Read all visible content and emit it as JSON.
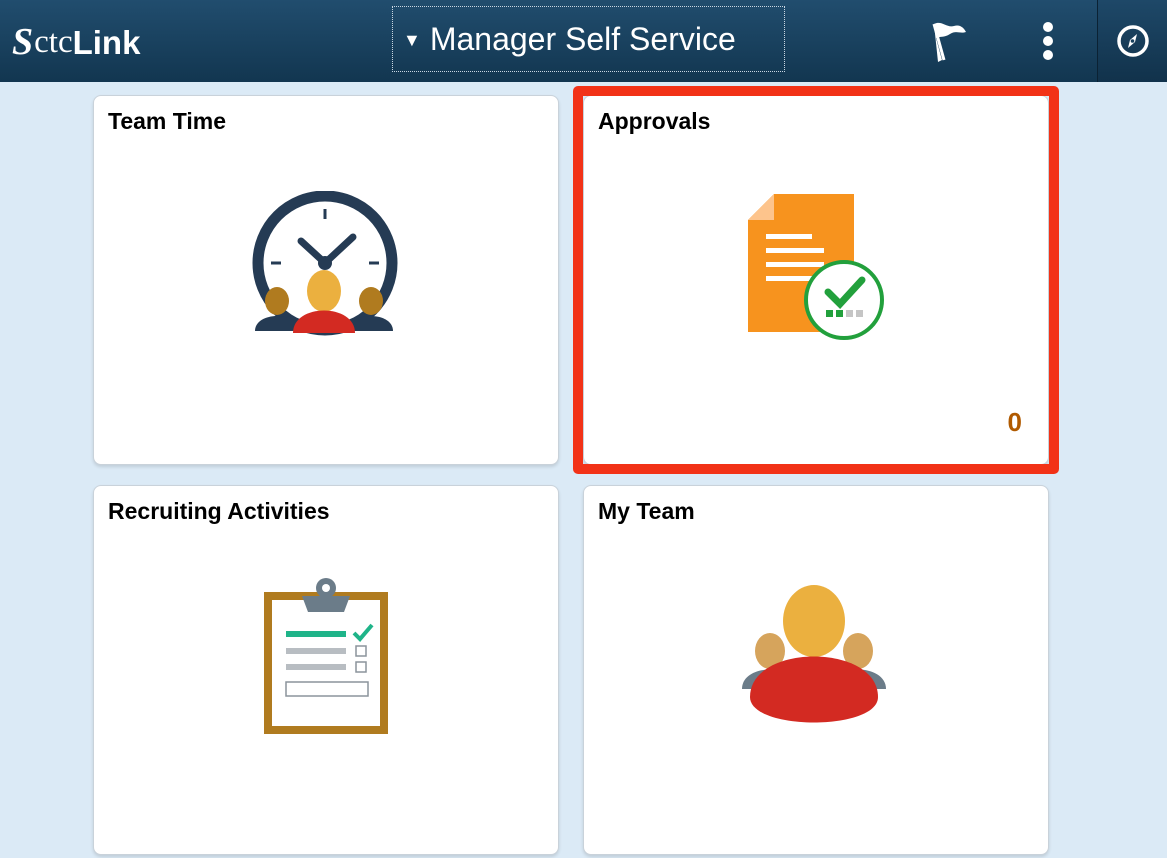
{
  "header": {
    "logo_s": "S",
    "logo_ctc": "ctc",
    "logo_link": "Link",
    "homepage_title": "Manager Self Service",
    "icons": {
      "homepage_dropdown": "triangle-down-icon",
      "notifications": "flag-icon",
      "actions": "vertical-ellipsis-icon",
      "navbar": "compass-icon"
    }
  },
  "tiles": [
    {
      "title": "Team Time",
      "icon": "team-time-clock-icon"
    },
    {
      "title": "Approvals",
      "icon": "approvals-document-check-icon",
      "count": "0",
      "highlighted": true
    },
    {
      "title": "Recruiting Activities",
      "icon": "clipboard-checklist-icon"
    },
    {
      "title": "My Team",
      "icon": "team-people-icon"
    }
  ],
  "colors": {
    "header_bg": "#123650",
    "page_bg": "#dbeaf6",
    "highlight_border": "#f23217",
    "count_color": "#b05a00"
  }
}
